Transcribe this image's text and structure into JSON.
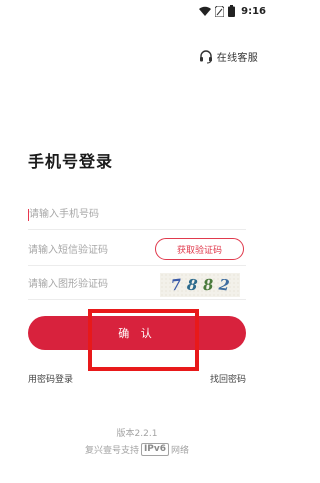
{
  "status_bar": {
    "time": "9:16",
    "icons": [
      "wifi-icon",
      "sim-icon",
      "battery-icon"
    ]
  },
  "service": {
    "label": "在线客服",
    "icon": "headset-icon"
  },
  "title": "手机号登录",
  "form": {
    "phone_placeholder": "请输入手机号码",
    "sms_placeholder": "请输入短信验证码",
    "sms_button_label": "获取验证码",
    "captcha_placeholder": "请输入图形验证码",
    "captcha_digits": [
      "7",
      "8",
      "8",
      "2"
    ],
    "confirm_label": "确 认"
  },
  "links": {
    "password_login": "用密码登录",
    "find_password": "找回密码"
  },
  "footer": {
    "version": "版本2.2.1",
    "ipv6_prefix": "复兴壹号支持",
    "ipv6_badge": "IPv6",
    "ipv6_suffix": "网络"
  },
  "colors": {
    "accent": "#d8223d",
    "highlight": "#e8191a"
  }
}
